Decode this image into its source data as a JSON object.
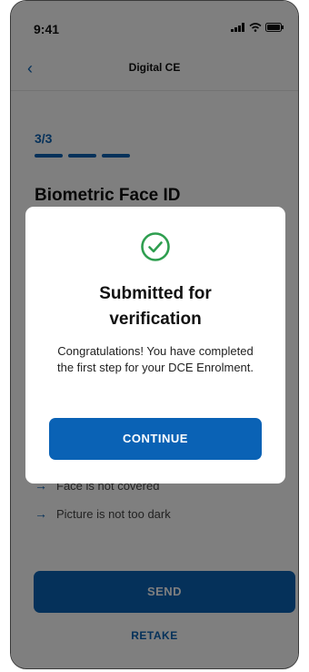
{
  "status_bar": {
    "time": "9:41"
  },
  "nav": {
    "title": "Digital CE"
  },
  "content": {
    "step": "3/3",
    "heading": "Biometric Face ID",
    "checklist": [
      "Face is not covered",
      "Picture is not too dark"
    ],
    "send_label": "SEND",
    "retake_label": "RETAKE"
  },
  "modal": {
    "icon": "check-circle-icon",
    "title": "Submitted for verification",
    "message": "Congratulations! You have completed the first step for your DCE Enrolment.",
    "continue_label": "CONTINUE"
  },
  "colors": {
    "primary": "#0a62b5",
    "success": "#2e9e4f",
    "overlay": "rgba(0,0,0,0.5)"
  }
}
